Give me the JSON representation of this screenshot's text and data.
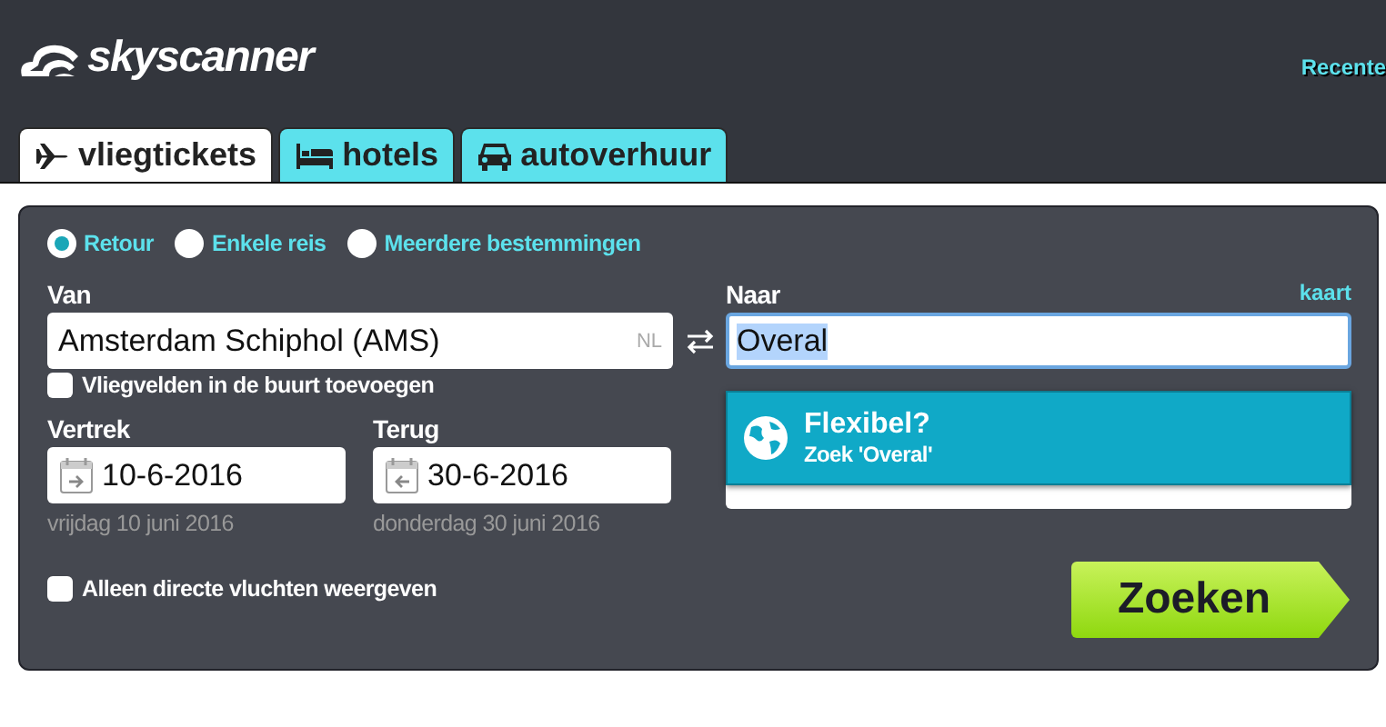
{
  "logo": {
    "text": "skyscanner"
  },
  "header_link": "Recente",
  "tabs": [
    {
      "label": "vliegtickets",
      "kind": "plane",
      "selected": true
    },
    {
      "label": "hotels",
      "kind": "bed",
      "selected": false
    },
    {
      "label": "autoverhuur",
      "kind": "car",
      "selected": false
    }
  ],
  "trip_types": [
    {
      "label": "Retour",
      "selected": true
    },
    {
      "label": "Enkele reis",
      "selected": false
    },
    {
      "label": "Meerdere bestemmingen",
      "selected": false
    }
  ],
  "from": {
    "label": "Van",
    "value": "Amsterdam Schiphol (AMS)",
    "country": "NL",
    "nearby": {
      "label": "Vliegvelden in de buurt toevoegen",
      "checked": false
    }
  },
  "to": {
    "label": "Naar",
    "map_link": "kaart",
    "value": "Overal",
    "value_selected": true
  },
  "suggestion": {
    "title": "Flexibel?",
    "subtitle": "Zoek 'Overal'"
  },
  "depart": {
    "label": "Vertrek",
    "value": "10-6-2016",
    "day": "vrijdag 10 juni 2016"
  },
  "return": {
    "label": "Terug",
    "value": "30-6-2016",
    "day": "donderdag 30 juni 2016"
  },
  "direct_only": {
    "label": "Alleen directe vluchten weergeven",
    "checked": false
  },
  "search_button": "Zoeken"
}
